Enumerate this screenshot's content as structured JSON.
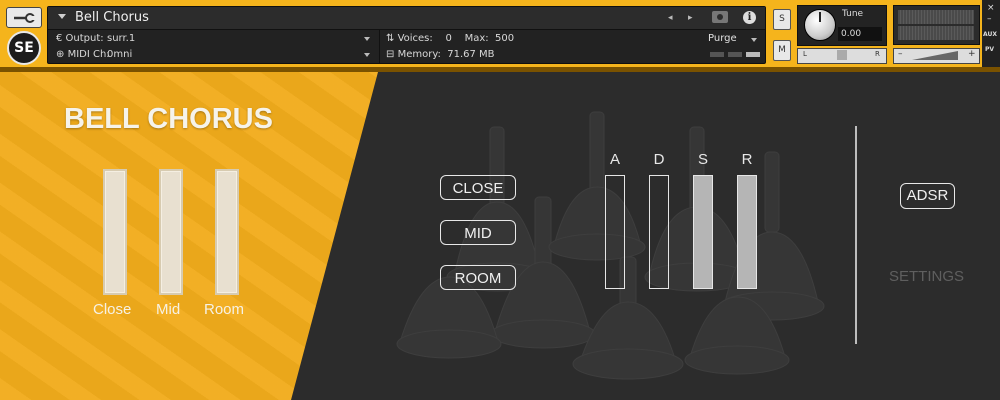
{
  "header": {
    "logo_text": "SE",
    "instrument_name": "Bell Chorus",
    "output_label": "Output:",
    "output_value": "surr.1",
    "midi_label": "MIDI Ch:",
    "midi_value": "0mni",
    "voices_label": "Voices:",
    "voices_value": "0",
    "max_label": "Max:",
    "max_value": "500",
    "memory_label": "Memory:",
    "memory_value": "71.67 MB",
    "purge_label": "Purge",
    "solo_label": "S",
    "mute_label": "M",
    "tune_label": "Tune",
    "tune_value": "0.00",
    "pan_left": "L",
    "pan_right": "R",
    "vol_minus": "–",
    "vol_plus": "+",
    "close_glyph": "×",
    "minimize_glyph": "–",
    "aux_label": "AUX",
    "pv_label": "PV",
    "nav_prev": "◂",
    "nav_next": "▸",
    "info_glyph": "i"
  },
  "mixer": {
    "title": "BELL CHORUS",
    "sliders": [
      {
        "label": "Close",
        "value": 1.0
      },
      {
        "label": "Mid",
        "value": 1.0
      },
      {
        "label": "Room",
        "value": 1.0
      }
    ]
  },
  "mic_buttons": [
    "CLOSE",
    "MID",
    "ROOM"
  ],
  "envelope": {
    "letters": [
      "A",
      "D",
      "S",
      "R"
    ],
    "levels": [
      0.0,
      0.0,
      1.0,
      1.0
    ]
  },
  "right_panel": {
    "adsr_label": "ADSR",
    "settings_label": "SETTINGS"
  },
  "colors": {
    "accent": "#f2ac1c",
    "dark_bg": "#2c2c2c"
  }
}
